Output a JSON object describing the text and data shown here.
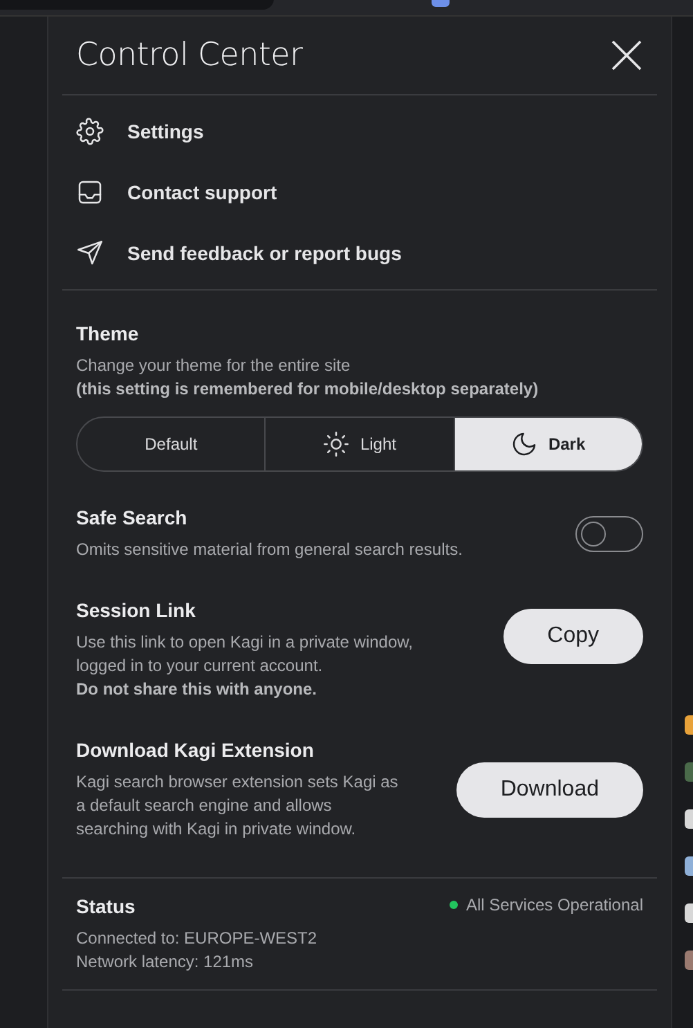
{
  "panel": {
    "title": "Control Center"
  },
  "menu": [
    {
      "kind": "settings",
      "label": "Settings"
    },
    {
      "kind": "support",
      "label": "Contact support"
    },
    {
      "kind": "feedback",
      "label": "Send feedback or report bugs"
    }
  ],
  "theme": {
    "title": "Theme",
    "description": "Change your theme for the entire site",
    "note": "(this setting is remembered for mobile/desktop separately)",
    "options": [
      {
        "kind": "default",
        "label": "Default",
        "selected": false
      },
      {
        "kind": "light",
        "label": "Light",
        "selected": false
      },
      {
        "kind": "dark",
        "label": "Dark",
        "selected": true
      }
    ]
  },
  "safe_search": {
    "title": "Safe Search",
    "description": "Omits sensitive material from general search results.",
    "on": false
  },
  "session_link": {
    "title": "Session Link",
    "description": "Use this link to open Kagi in a private window, logged in to your current account.",
    "warning": "Do not share this with anyone.",
    "button": "Copy"
  },
  "extension": {
    "title": "Download Kagi Extension",
    "description": "Kagi search browser extension sets Kagi as a default search engine and allows searching with Kagi in private window.",
    "button": "Download"
  },
  "status": {
    "title": "Status",
    "indicator": "All Services Operational",
    "color": "#22c55e",
    "lines": [
      "Connected to: EUROPE-WEST2",
      "Network latency: 121ms"
    ]
  }
}
